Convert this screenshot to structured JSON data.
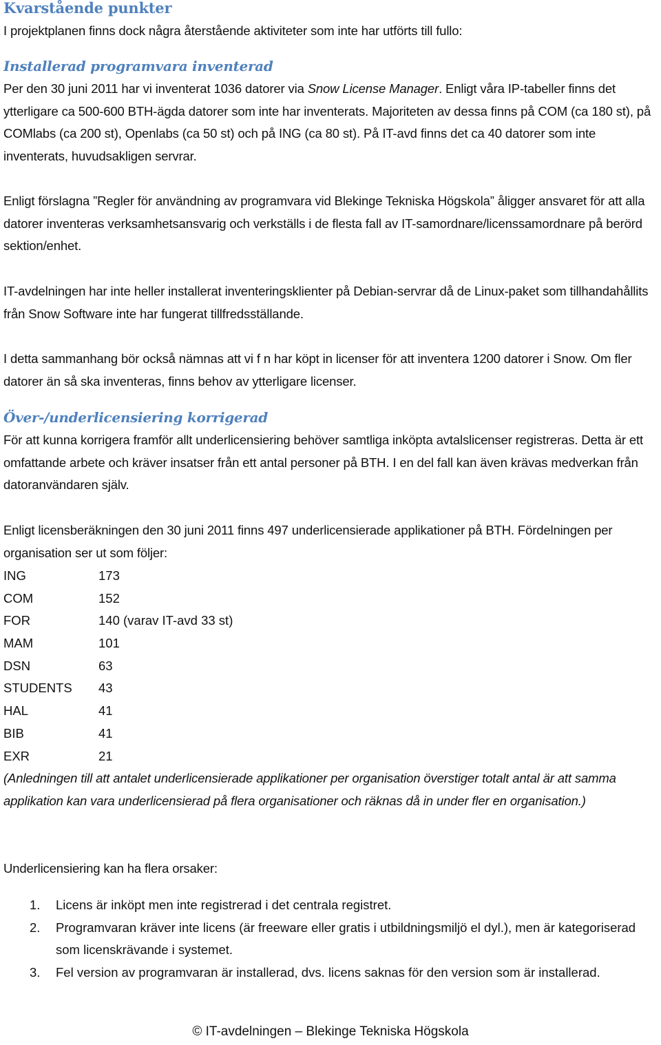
{
  "sections": {
    "main_heading": "Kvarstående punkter",
    "intro": "I projektplanen finns dock några återstående aktiviteter som inte har utförts till fullo:",
    "installed": {
      "heading": "Installerad programvara inventerad",
      "p1_before": "Per den 30 juni 2011 har vi inventerat 1036 datorer via ",
      "p1_italic": "Snow License Manager",
      "p1_after": ". Enligt våra IP-tabeller finns det ytterligare ca 500-600 BTH-ägda datorer som inte har inventerats. Majoriteten av dessa finns på COM (ca 180 st), på COMlabs (ca 200 st), Openlabs (ca 50 st) och på ING (ca 80 st). På IT-avd finns det ca 40 datorer som inte inventerats, huvudsakligen servrar.",
      "p2": "Enligt förslagna ”Regler för användning av programvara vid Blekinge Tekniska Högskola” åligger ansvaret för att alla datorer inventeras verksamhetsansvarig och verkställs i de flesta fall av IT-samordnare/licenssamordnare på berörd sektion/enhet.",
      "p3": "IT-avdelningen har inte heller installerat inventeringsklienter på Debian-servrar då de Linux-paket som tillhandahållits från Snow Software inte har fungerat tillfredsställande.",
      "p4": "I detta sammanhang bör också nämnas att vi f n har köpt in licenser för att inventera 1200 datorer i Snow. Om fler datorer än så ska inventeras, finns behov av ytterligare licenser."
    },
    "underlicensing": {
      "heading": "Över-/underlicensiering korrigerad",
      "p1": "För att kunna korrigera framför allt underlicensiering behöver samtliga inköpta avtalslicenser registreras. Detta är ett omfattande arbete och kräver insatser från ett antal personer på BTH. I en del fall kan även krävas medverkan från datoranvändaren själv.",
      "p2": "Enligt licensberäkningen den 30 juni 2011 finns 497 underlicensierade applikationer på BTH. Fördelningen per organisation ser ut som följer:",
      "organisations": [
        {
          "name": "ING",
          "count": "173"
        },
        {
          "name": "COM",
          "count": "152"
        },
        {
          "name": "FOR",
          "count": "140 (varav IT-avd 33 st)"
        },
        {
          "name": "MAM",
          "count": "101"
        },
        {
          "name": "DSN",
          "count": "63"
        },
        {
          "name": "STUDENTS",
          "count": "43"
        },
        {
          "name": "HAL",
          "count": "41"
        },
        {
          "name": "BIB",
          "count": "41"
        },
        {
          "name": "EXR",
          "count": "21"
        }
      ],
      "note": "(Anledningen till att antalet underlicensierade applikationer per organisation överstiger totalt antal är att samma applikation kan vara underlicensierad på flera organisationer och räknas då in under fler en organisation.)",
      "causes_intro": "Underlicensiering kan ha flera orsaker:",
      "causes": [
        {
          "num": "1.",
          "text": "Licens är inköpt men inte registrerad i det centrala registret."
        },
        {
          "num": "2.",
          "text": "Programvaran kräver inte licens (är freeware eller gratis i utbildningsmiljö el dyl.), men är kategoriserad som licenskrävande i systemet."
        },
        {
          "num": "3.",
          "text": "Fel version av programvaran är installerad, dvs. licens saknas för den version som är installerad."
        }
      ]
    }
  },
  "footer": "© IT-avdelningen – Blekinge Tekniska Högskola"
}
